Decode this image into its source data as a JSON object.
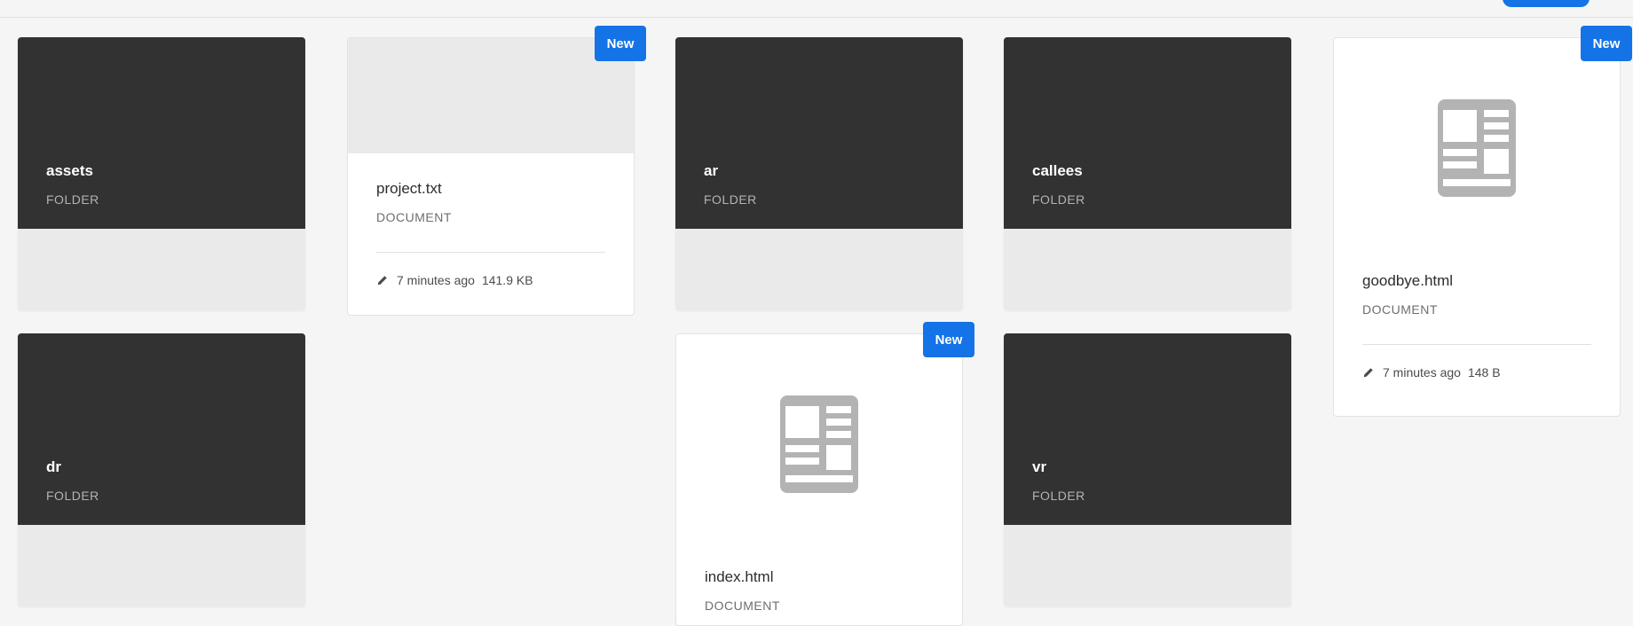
{
  "badge_label": "New",
  "folder_type_label": "FOLDER",
  "document_type_label": "DOCUMENT",
  "folders": [
    {
      "name": "assets"
    },
    {
      "name": "ar"
    },
    {
      "name": "callees"
    },
    {
      "name": "dr"
    },
    {
      "name": "vr"
    }
  ],
  "documents": [
    {
      "name": "project.txt",
      "modified": "7 minutes ago",
      "size": "141.9 KB",
      "is_new": true
    },
    {
      "name": "goodbye.html",
      "modified": "7 minutes ago",
      "size": "148 B",
      "is_new": true
    },
    {
      "name": "index.html",
      "is_new": true
    }
  ],
  "colors": {
    "accent": "#1473e6",
    "folder_bg": "#323232",
    "card_bg": "#ffffff",
    "page_bg": "#f5f5f5",
    "doc_icon": "#b3b3b3"
  },
  "icons": {
    "document": "document-icon",
    "edit": "pencil-icon"
  }
}
